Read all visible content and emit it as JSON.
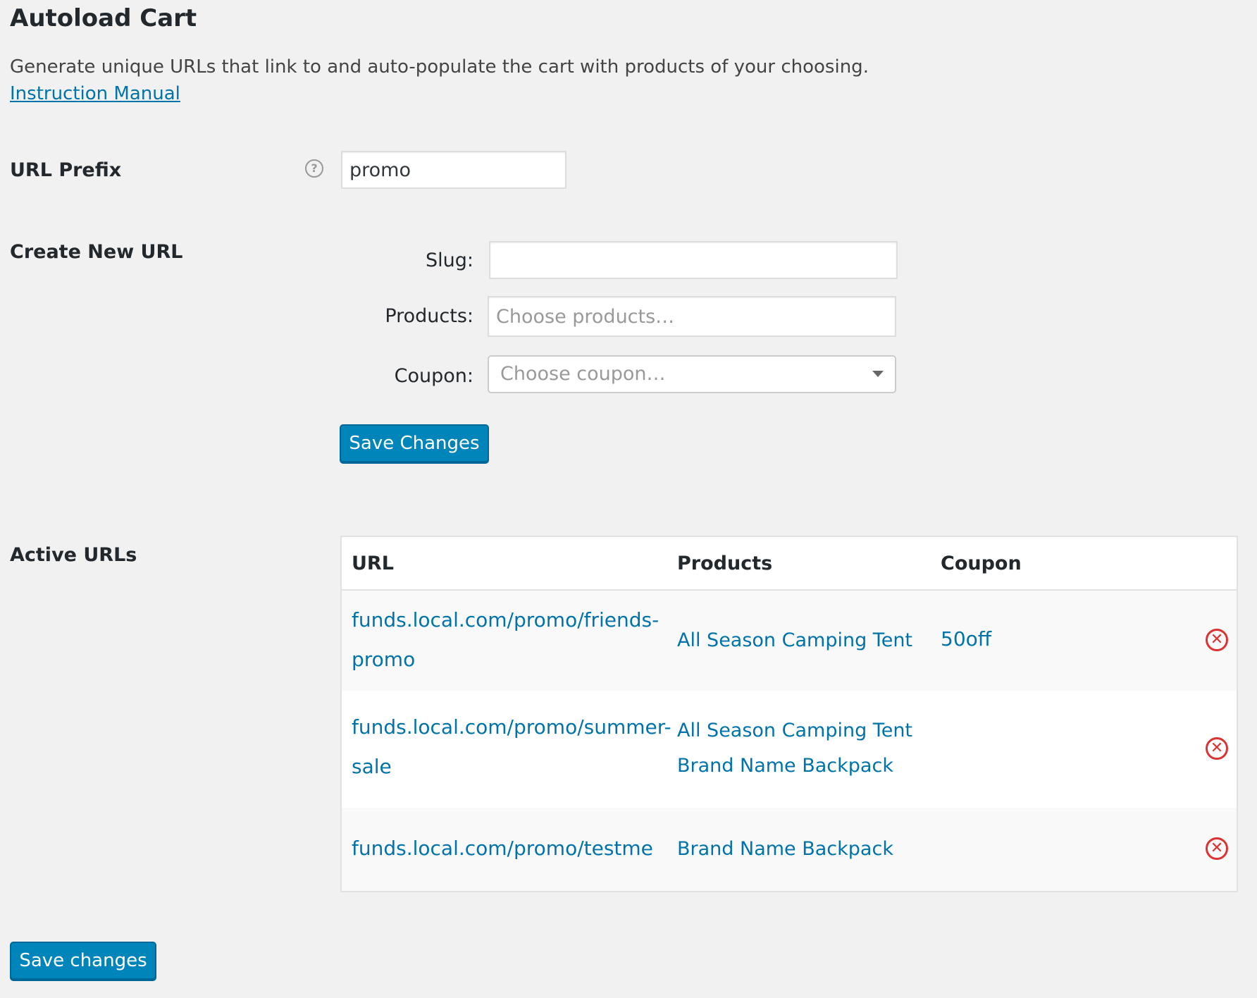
{
  "page": {
    "title": "Autoload Cart",
    "description": "Generate unique URLs that link to and auto-populate the cart with products of your choosing.",
    "manual_link": "Instruction Manual"
  },
  "url_prefix": {
    "label": "URL Prefix",
    "help_icon": "question-circle-icon",
    "help_glyph": "?",
    "value": "promo"
  },
  "create_new": {
    "label": "Create New URL",
    "slug_label": "Slug:",
    "slug_value": "",
    "products_label": "Products:",
    "products_placeholder": "Choose products…",
    "coupon_label": "Coupon:",
    "coupon_placeholder": "Choose coupon…",
    "save_button": "Save Changes"
  },
  "active_urls": {
    "label": "Active URLs",
    "columns": [
      "URL",
      "Products",
      "Coupon"
    ],
    "rows": [
      {
        "url_line1": "funds.local.com/promo/friends-",
        "url_line2": "promo",
        "products": [
          "All Season Camping Tent"
        ],
        "coupon": "50off"
      },
      {
        "url_line1": "funds.local.com/promo/summer-",
        "url_line2": "sale",
        "products": [
          "All Season Camping Tent",
          "Brand Name Backpack"
        ],
        "coupon": ""
      },
      {
        "url_line1": "funds.local.com/promo/testme",
        "url_line2": "",
        "products": [
          "Brand Name Backpack"
        ],
        "coupon": ""
      }
    ],
    "delete_glyph": "✕"
  },
  "footer": {
    "save_button": "Save changes"
  },
  "colors": {
    "background": "#f1f1f1",
    "link": "#0073aa",
    "primary_button": "#0085ba",
    "delete": "#dc3232"
  }
}
